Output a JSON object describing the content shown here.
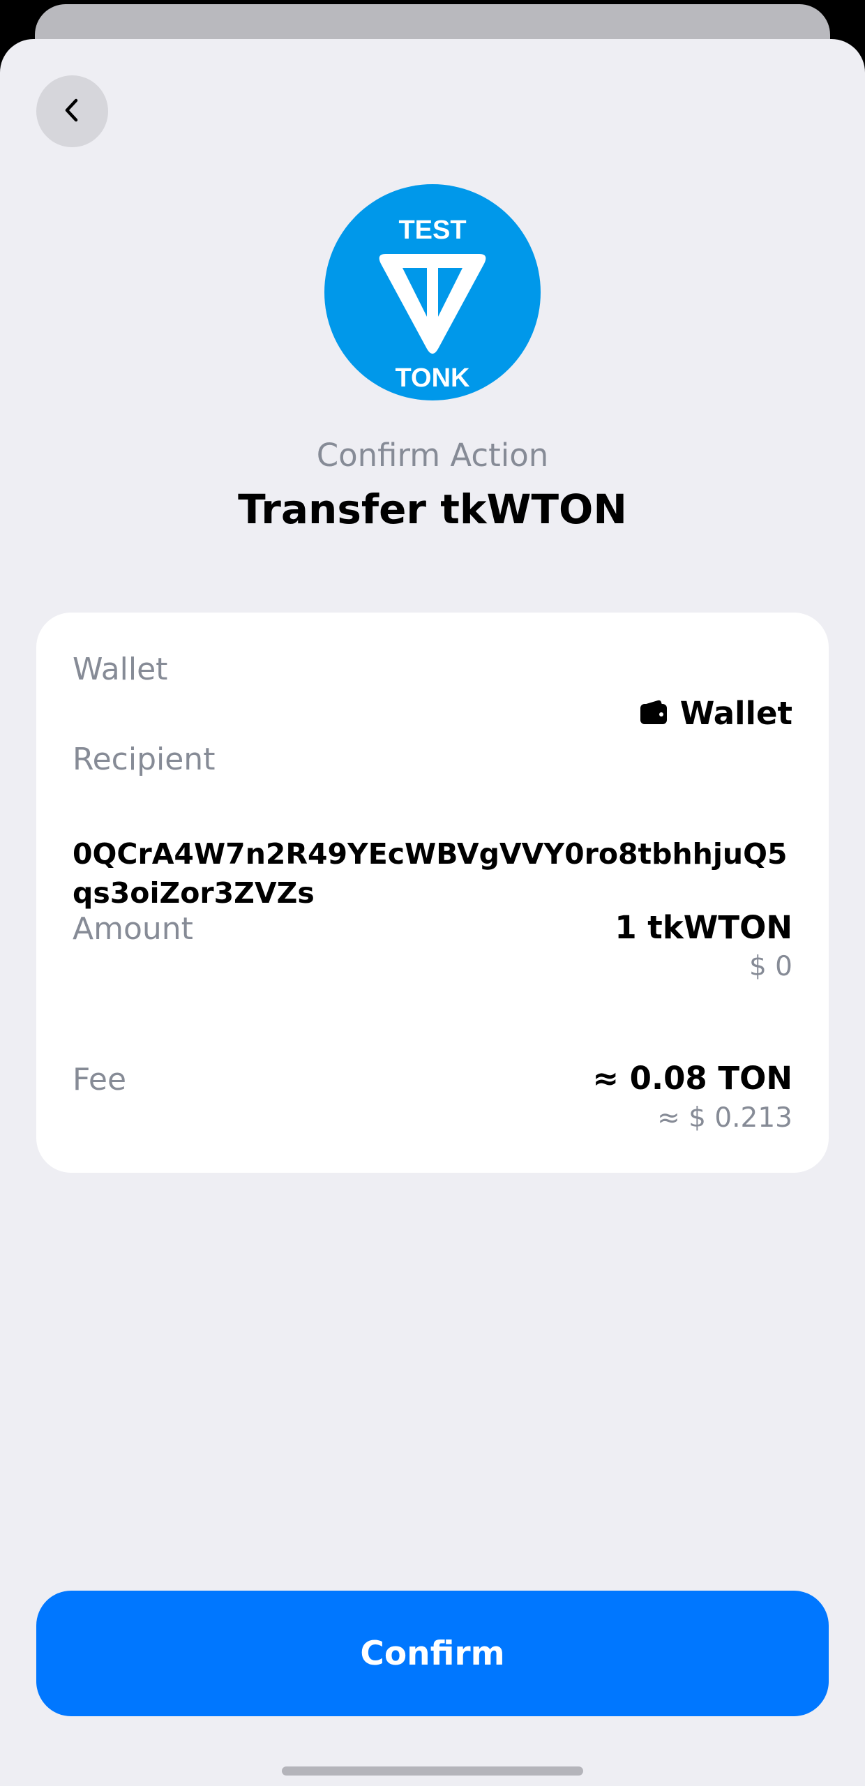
{
  "header": {
    "subtitle": "Confirm Action",
    "title": "Transfer tkWTON"
  },
  "token_logo": {
    "top_text": "TEST",
    "bottom_text": "TONK",
    "color": "#0098EA"
  },
  "details": {
    "wallet_label": "Wallet",
    "wallet_value": "Wallet",
    "recipient_label": "Recipient",
    "recipient_value": "0QCrA4W7n2R49YEcWBVgVVY0ro8tbhhjuQ5qs3oiZor3ZVZs",
    "amount_label": "Amount",
    "amount_value": "1 tkWTON",
    "amount_fiat": "$ 0",
    "fee_label": "Fee",
    "fee_value": "≈ 0.08 TON",
    "fee_fiat": "≈ $ 0.213"
  },
  "actions": {
    "confirm_label": "Confirm"
  },
  "icons": {
    "back": "chevron-left-icon",
    "wallet": "wallet-icon"
  },
  "colors": {
    "accent": "#0077FF",
    "background": "#EEEEF3",
    "card": "#FFFFFF",
    "muted_text": "#868B96"
  }
}
